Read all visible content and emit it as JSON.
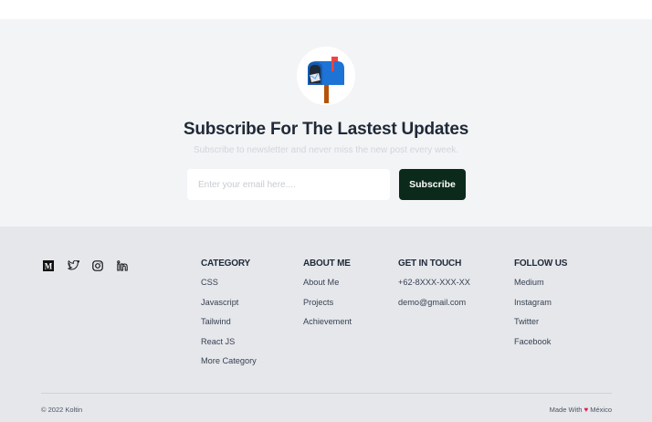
{
  "subscribe": {
    "title": "Subscribe For The Lastest Updates",
    "description": "Subscribe to newsletter and never miss the new post every week.",
    "input_placeholder": "Enter your email here....",
    "button_label": "Subscribe",
    "icon": "mailbox-icon"
  },
  "social": [
    {
      "icon": "medium-icon"
    },
    {
      "icon": "twitter-icon"
    },
    {
      "icon": "instagram-icon"
    },
    {
      "icon": "linkedin-icon"
    }
  ],
  "columns": {
    "category": {
      "heading": "CATEGORY",
      "items": [
        "CSS",
        "Javascript",
        "Tailwind",
        "React JS",
        "More Category"
      ]
    },
    "about": {
      "heading": "ABOUT ME",
      "items": [
        "About Me",
        "Projects",
        "Achievement"
      ]
    },
    "contact": {
      "heading": "GET IN TOUCH",
      "items": [
        "+62-8XXX-XXX-XX",
        "demo@gmail.com"
      ]
    },
    "follow": {
      "heading": "FOLLOW US",
      "items": [
        "Medium",
        "Instagram",
        "Twitter",
        "Facebook"
      ]
    }
  },
  "footer": {
    "copyright": "© 2022 Koltin",
    "made_with_prefix": "Made With",
    "made_with_suffix": "México",
    "heart_color": "#e11d48"
  },
  "colors": {
    "button_bg": "#0b2a1b",
    "subscribe_bg": "#f3f4f6",
    "footer_bg": "#e5e7eb"
  }
}
